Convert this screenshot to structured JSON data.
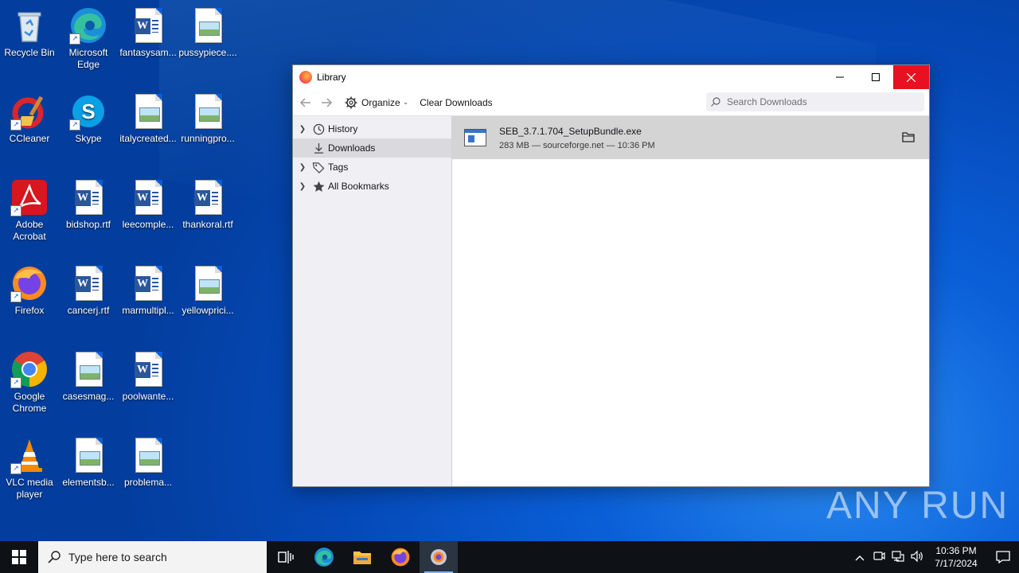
{
  "desktop_icons": [
    {
      "label": "Recycle Bin"
    },
    {
      "label": "Microsoft Edge"
    },
    {
      "label": "fantasysam..."
    },
    {
      "label": "pussypiece...."
    },
    {
      "label": "CCleaner"
    },
    {
      "label": "Skype"
    },
    {
      "label": "italycreated..."
    },
    {
      "label": "runningpro..."
    },
    {
      "label": "Adobe Acrobat"
    },
    {
      "label": "bidshop.rtf"
    },
    {
      "label": "leecomple..."
    },
    {
      "label": "thankoral.rtf"
    },
    {
      "label": "Firefox"
    },
    {
      "label": "cancerj.rtf"
    },
    {
      "label": "marmultipl..."
    },
    {
      "label": "yellowprici..."
    },
    {
      "label": "Google Chrome"
    },
    {
      "label": "casesmag..."
    },
    {
      "label": "poolwante..."
    },
    {
      "label": "VLC media player"
    },
    {
      "label": "elementsb..."
    },
    {
      "label": "problema..."
    }
  ],
  "window": {
    "title": "Library",
    "toolbar": {
      "organize_label": "Organize",
      "clear_label": "Clear Downloads",
      "search_placeholder": "Search Downloads"
    },
    "sidebar": [
      {
        "label": "History",
        "icon": "clock-icon",
        "expandable": true
      },
      {
        "label": "Downloads",
        "icon": "download-icon",
        "expandable": false,
        "selected": true
      },
      {
        "label": "Tags",
        "icon": "tag-icon",
        "expandable": true
      },
      {
        "label": "All Bookmarks",
        "icon": "star-icon",
        "expandable": true
      }
    ],
    "downloads": [
      {
        "filename": "SEB_3.7.1.704_SetupBundle.exe",
        "meta": "283 MB — sourceforge.net — 10:36 PM"
      }
    ]
  },
  "taskbar": {
    "search_placeholder": "Type here to search",
    "time": "10:36 PM",
    "date": "7/17/2024"
  },
  "watermark": "ANY RUN"
}
